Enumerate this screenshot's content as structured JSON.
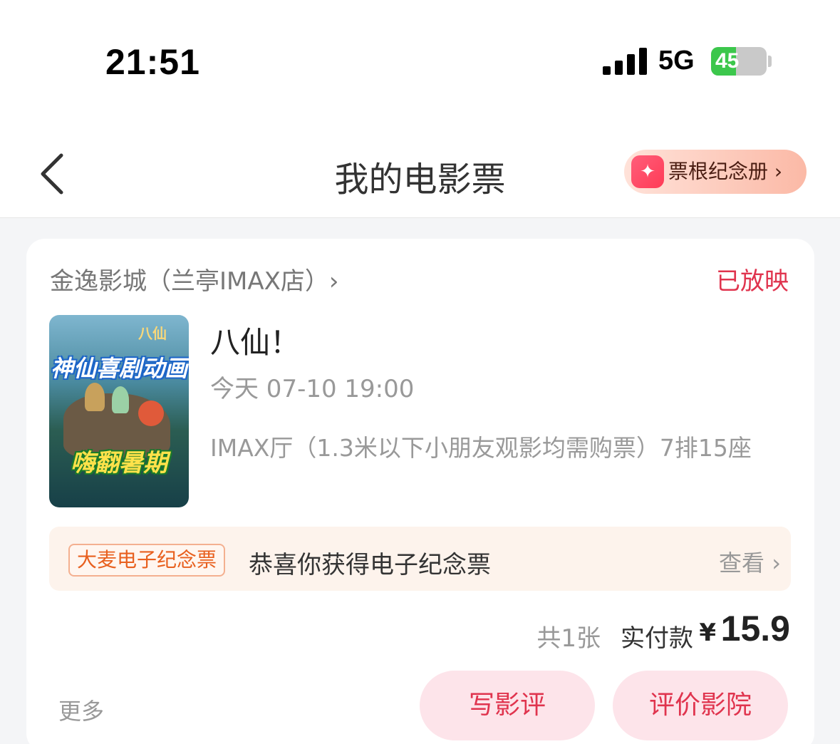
{
  "status_bar": {
    "time": "21:51",
    "network": "5G",
    "battery": "45",
    "battery_level": 0.45
  },
  "nav": {
    "title": "我的电影票",
    "album_label": "票根纪念册 ›",
    "album_icon": "sparkle-ticket-icon"
  },
  "order": {
    "cinema": "金逸影城（兰亭IMAX店）›",
    "status": "已放映",
    "poster": {
      "logo": "八仙",
      "slogan_top": "神仙喜剧动画",
      "slogan_bottom": "嗨翻暑期"
    },
    "movie_title": "八仙！",
    "show_time": "今天 07-10 19:00",
    "hall_seat": "IMAX厅（1.3米以下小朋友观影均需购票）7排15座",
    "souvenir": {
      "tag": "大麦电子纪念票",
      "text": "恭喜你获得电子纪念票",
      "view": "查看 ›"
    },
    "count": "共1张",
    "paid_label": "实付款",
    "currency": "¥",
    "amount": "15.9",
    "more": "更多",
    "btn_review": "写影评",
    "btn_rate": "评价影院"
  }
}
